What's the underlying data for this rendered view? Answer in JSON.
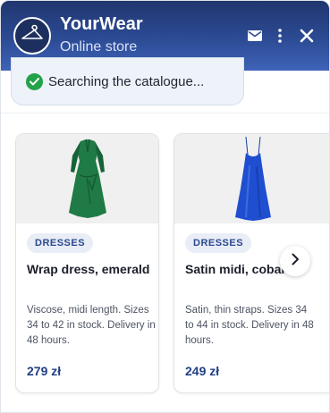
{
  "header": {
    "brand_name": "YourWear",
    "subtitle": "Online store",
    "icons": [
      "hanger-icon",
      "mail-icon",
      "more-vertical-icon",
      "close-icon"
    ]
  },
  "status": {
    "text": "Searching the catalogue...",
    "icon": "check-circle-icon"
  },
  "products": [
    {
      "category": "DRESSES",
      "title": "Wrap dress, emerald",
      "description": "Viscose, midi length. Sizes 34 to 42 in stock. Delivery in 48 hours.",
      "price": "279 zł",
      "image": "green-wrap-dress-image"
    },
    {
      "category": "DRESSES",
      "title": "Satin midi, cobalt",
      "description": "Satin, thin straps. Sizes 34 to 44 in stock. Delivery in 48 hours.",
      "price": "249 zł",
      "image": "blue-satin-slip-dress-image"
    }
  ],
  "carousel": {
    "next_icon": "chevron-right-icon"
  },
  "colors": {
    "header_top": "#20366f",
    "header_bottom": "#3e63b8",
    "accent": "#213f82",
    "success": "#22a249",
    "emerald": "#1f7a45",
    "cobalt": "#1f4fd0"
  }
}
